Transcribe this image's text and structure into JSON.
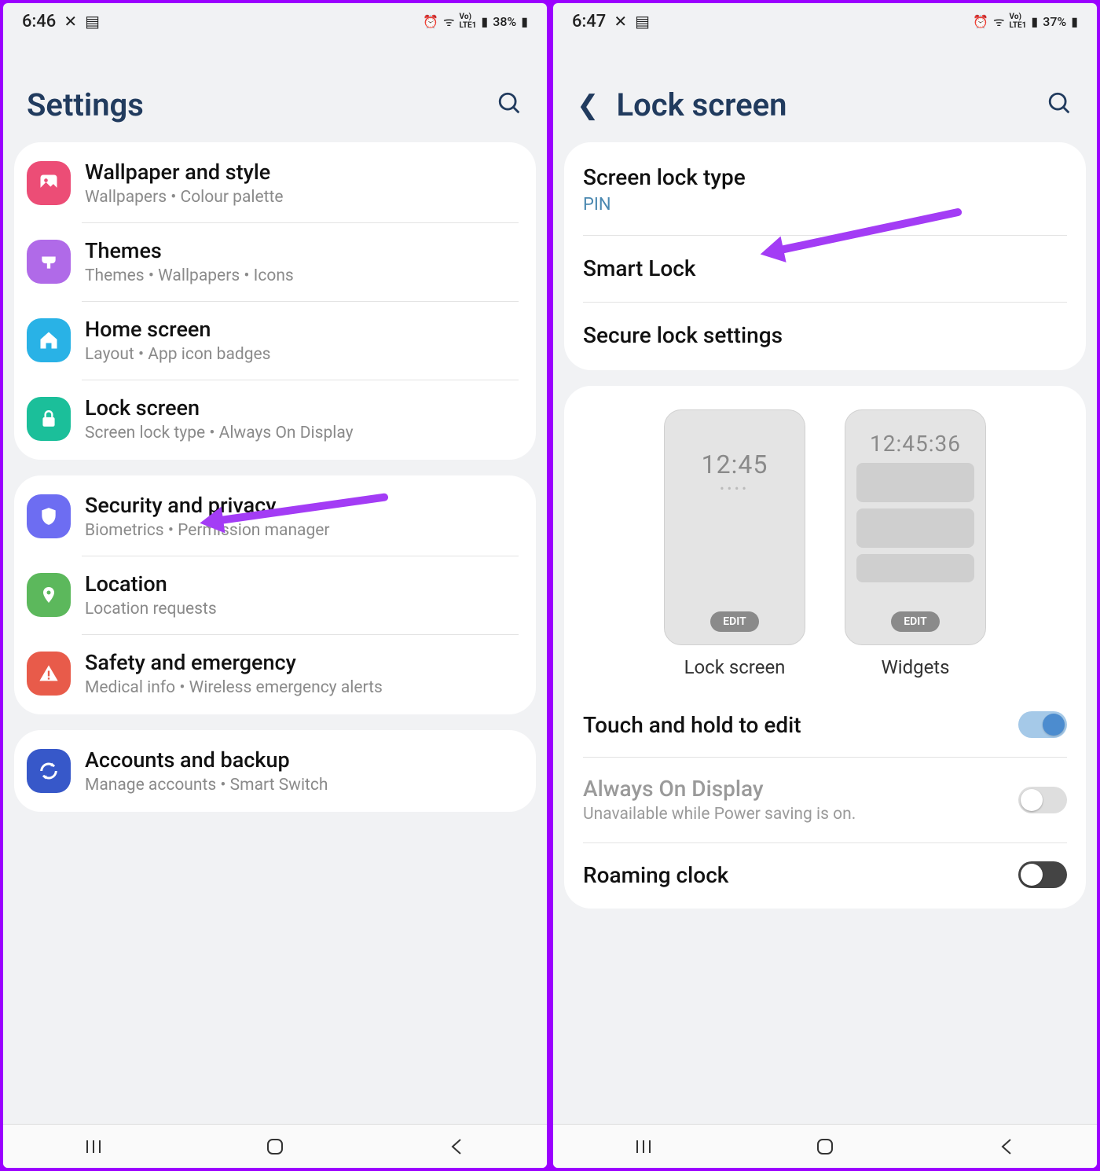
{
  "left": {
    "status": {
      "time": "6:46",
      "battery": "38%"
    },
    "header": {
      "title": "Settings"
    },
    "groups": [
      {
        "items": [
          {
            "icon": "wallpaper-icon",
            "color": "#ec4d76",
            "title": "Wallpaper and style",
            "sub": "Wallpapers  •  Colour palette"
          },
          {
            "icon": "themes-icon",
            "color": "#b06ae8",
            "title": "Themes",
            "sub": "Themes  •  Wallpapers  •  Icons"
          },
          {
            "icon": "home-icon",
            "color": "#29b2e6",
            "title": "Home screen",
            "sub": "Layout  •  App icon badges"
          },
          {
            "icon": "lock-icon",
            "color": "#1bbf9a",
            "title": "Lock screen",
            "sub": "Screen lock type  •  Always On Display"
          }
        ]
      },
      {
        "items": [
          {
            "icon": "shield-icon",
            "color": "#6d6df2",
            "title": "Security and privacy",
            "sub": "Biometrics  •  Permission manager"
          },
          {
            "icon": "location-icon",
            "color": "#5cb85c",
            "title": "Location",
            "sub": "Location requests"
          },
          {
            "icon": "warning-icon",
            "color": "#e85b4a",
            "title": "Safety and emergency",
            "sub": "Medical info  •  Wireless emergency alerts"
          }
        ]
      },
      {
        "items": [
          {
            "icon": "sync-icon",
            "color": "#3758c9",
            "title": "Accounts and backup",
            "sub": "Manage accounts  •  Smart Switch"
          }
        ]
      }
    ]
  },
  "right": {
    "status": {
      "time": "6:47",
      "battery": "37%"
    },
    "header": {
      "title": "Lock screen"
    },
    "section1": [
      {
        "title": "Screen lock type",
        "sub": "PIN"
      },
      {
        "title": "Smart Lock"
      },
      {
        "title": "Secure lock settings"
      }
    ],
    "preview": {
      "lock": {
        "time": "12:45",
        "edit": "EDIT",
        "label": "Lock screen"
      },
      "widgets": {
        "time": "12:45:36",
        "edit": "EDIT",
        "label": "Widgets"
      }
    },
    "toggles": [
      {
        "title": "Touch and hold to edit",
        "state": "on"
      },
      {
        "title": "Always On Display",
        "sub": "Unavailable while Power saving is on.",
        "state": "off",
        "disabled": true
      },
      {
        "title": "Roaming clock",
        "state": "blk"
      }
    ]
  }
}
